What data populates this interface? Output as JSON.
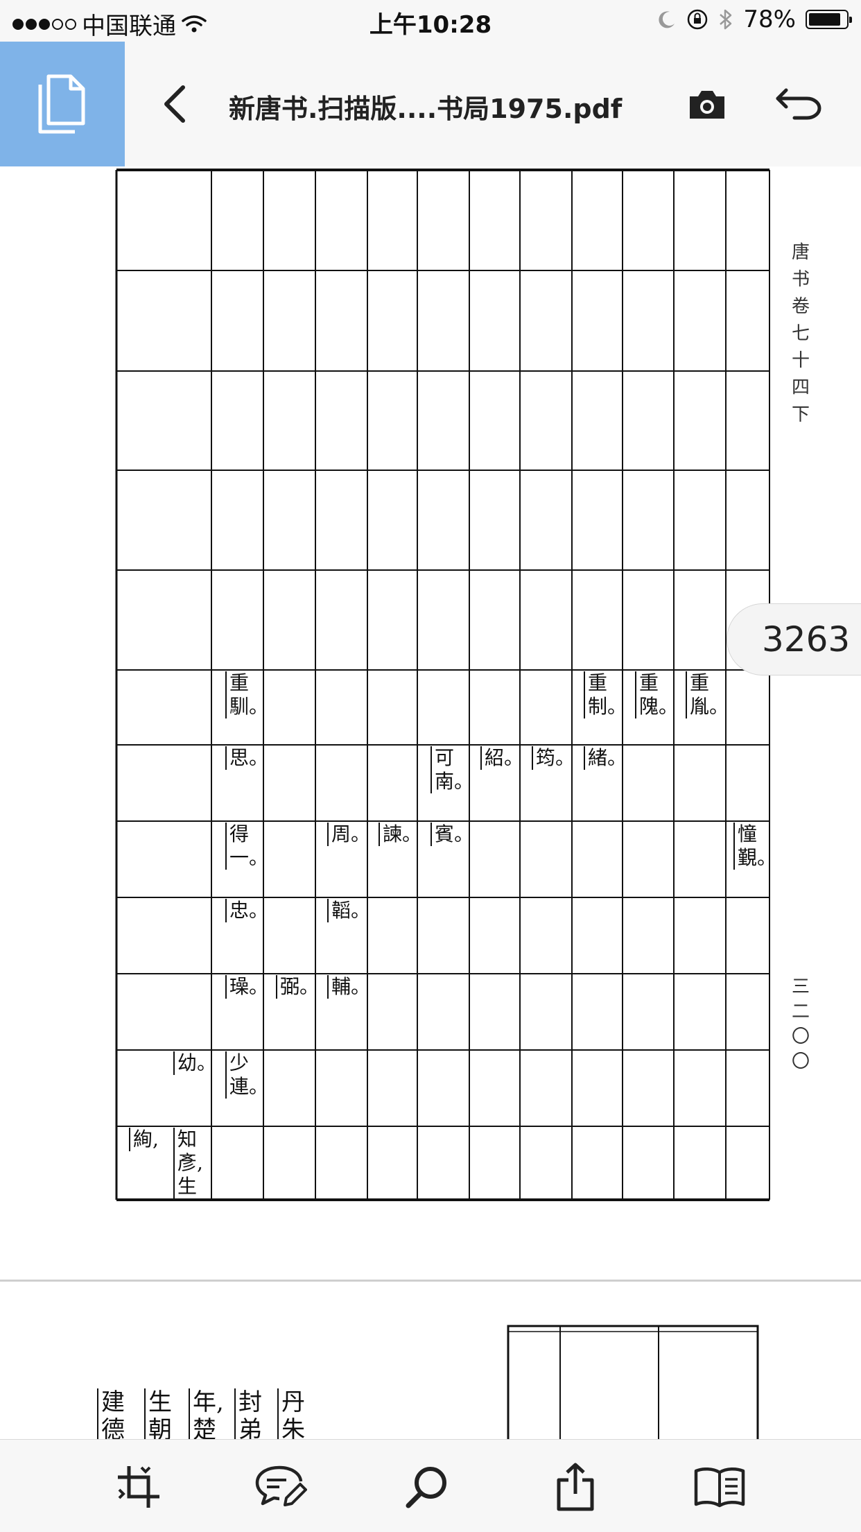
{
  "status": {
    "carrier": "中国联通",
    "time": "上午10:28",
    "battery": "78%",
    "battery_level": 0.78,
    "signal_bars": 3,
    "signal_total": 5
  },
  "nav": {
    "title": "新唐书.扫描版....书局1975.pdf"
  },
  "page": {
    "side_caption": [
      "唐",
      "书",
      "卷",
      "七",
      "十",
      "四",
      "下"
    ],
    "side_page_number": [
      "三",
      "二",
      "〇",
      "〇"
    ],
    "cells": [
      {
        "text": "重馴。"
      },
      {
        "text": "重制。"
      },
      {
        "text": "重隗。"
      },
      {
        "text": "重胤。"
      },
      {
        "text": "思。"
      },
      {
        "text": "可南。"
      },
      {
        "text": "紹。"
      },
      {
        "text": "筠。"
      },
      {
        "text": "緒。"
      },
      {
        "text": "得一。"
      },
      {
        "text": "周。"
      },
      {
        "text": "諫。"
      },
      {
        "text": "賓。"
      },
      {
        "text": "憧覲。"
      },
      {
        "text": "忠。"
      },
      {
        "text": "韜。"
      },
      {
        "text": "璪。"
      },
      {
        "text": "弼。"
      },
      {
        "text": "輔。"
      },
      {
        "text": "幼。"
      },
      {
        "text": "少連。"
      },
      {
        "text": "絢,"
      },
      {
        "text": "知彥,生"
      }
    ],
    "bottom_columns": [
      "建德",
      "生朝",
      "年,楚",
      "封弟",
      "丹朱"
    ]
  },
  "badge": {
    "page_number": "3263"
  },
  "icons": {
    "doc_tile": "documents-icon",
    "back": "chevron-left-icon",
    "camera": "camera-icon",
    "undo": "undo-arrow-icon",
    "crop": "crop-pages-icon",
    "comment": "comment-pen-icon",
    "search": "search-icon",
    "share": "share-icon",
    "bookmarks": "book-open-icon"
  },
  "colors": {
    "doc_tile_bg": "#7fb3e8",
    "bar_bg": "#f7f7f7"
  }
}
